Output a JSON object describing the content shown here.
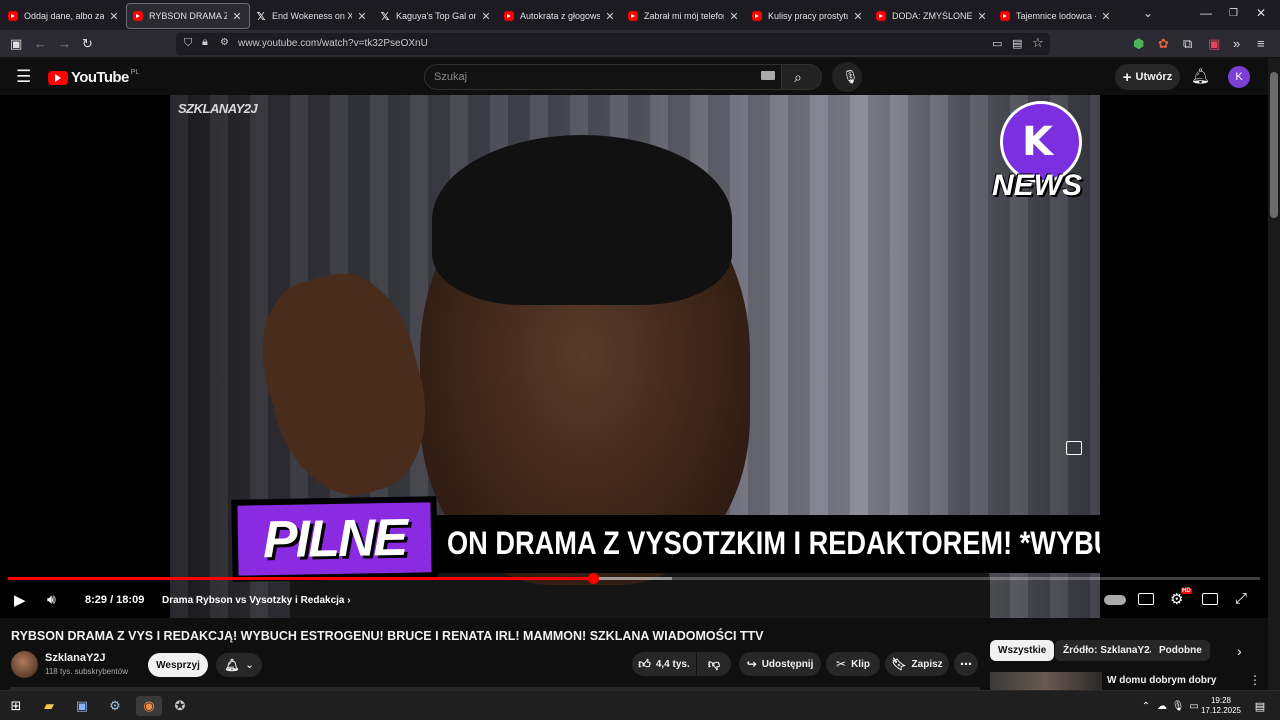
{
  "browser": {
    "tabs": [
      {
        "label": "Oddaj dane, albo zabierz",
        "favicon": "youtube-icon",
        "active": false
      },
      {
        "label": "RYBSON DRAMA Z VYS I",
        "favicon": "youtube-icon",
        "active": true
      },
      {
        "label": "End Wokeness on X:",
        "favicon": "x-icon",
        "active": false
      },
      {
        "label": "Kaguya's Top Gal on",
        "favicon": "x-icon",
        "active": false
      },
      {
        "label": "Autokrata z głogowskiej",
        "favicon": "youtube-icon",
        "active": false
      },
      {
        "label": "Zabrał mi mój telefon w",
        "favicon": "youtube-icon",
        "active": false
      },
      {
        "label": "Kulisy pracy prostytutki.",
        "favicon": "youtube-icon",
        "active": false
      },
      {
        "label": "DODA: ZMYŚLONE ŻYCIE",
        "favicon": "youtube-icon",
        "active": false
      },
      {
        "label": "Tajemnice lodowca - You",
        "favicon": "youtube-icon",
        "active": false
      }
    ],
    "url": "www.youtube.com/watch?v=tk32PseOXnU"
  },
  "yt_header": {
    "logo_text": "YouTube",
    "region": "PL",
    "search_placeholder": "Szukaj",
    "create_label": "Utwórz",
    "avatar_letter": "K"
  },
  "player": {
    "watermark": "SZKLANAY2J",
    "news_logo_text": "NEWS",
    "banner_label": "PILNE",
    "ticker_text": "ON DRAMA Z VYSOTZKIM I REDAKTOREM! *WYBU",
    "current_time": "8:29",
    "duration": "18:09",
    "time_display": "8:29 / 18:09",
    "chapter": "Drama Rybson vs Vysotzky i Redakcja",
    "played_fraction": 0.467,
    "buffered_fraction": 0.53
  },
  "video": {
    "title": "RYBSON DRAMA Z VYS I REDAKCJĄ! WYBUCH ESTROGENU! BRUCE I RENATA IRL! MAMMON! SZKLANA WIADOMOŚCI TTV",
    "channel_name": "SzklanaY2J",
    "subscribers": "118 tys. subskrybentów",
    "support_label": "Wesprzyj",
    "likes": "4,4 tys.",
    "share_label": "Udostępnij",
    "clip_label": "Klip",
    "save_label": "Zapisz"
  },
  "chips": [
    {
      "label": "Wszystkie",
      "active": true
    },
    {
      "label": "Źródło: SzklanaY2J",
      "active": false
    },
    {
      "label": "Podobne",
      "active": false
    }
  ],
  "recommendation": {
    "title": "W domu dobrym dobry"
  },
  "taskbar": {
    "time": "19:28",
    "date": "17.12.2025"
  },
  "colors": {
    "yt_red": "#ff0000",
    "accent_purple": "#8a2be2",
    "avatar_purple": "#7b3fd6"
  }
}
